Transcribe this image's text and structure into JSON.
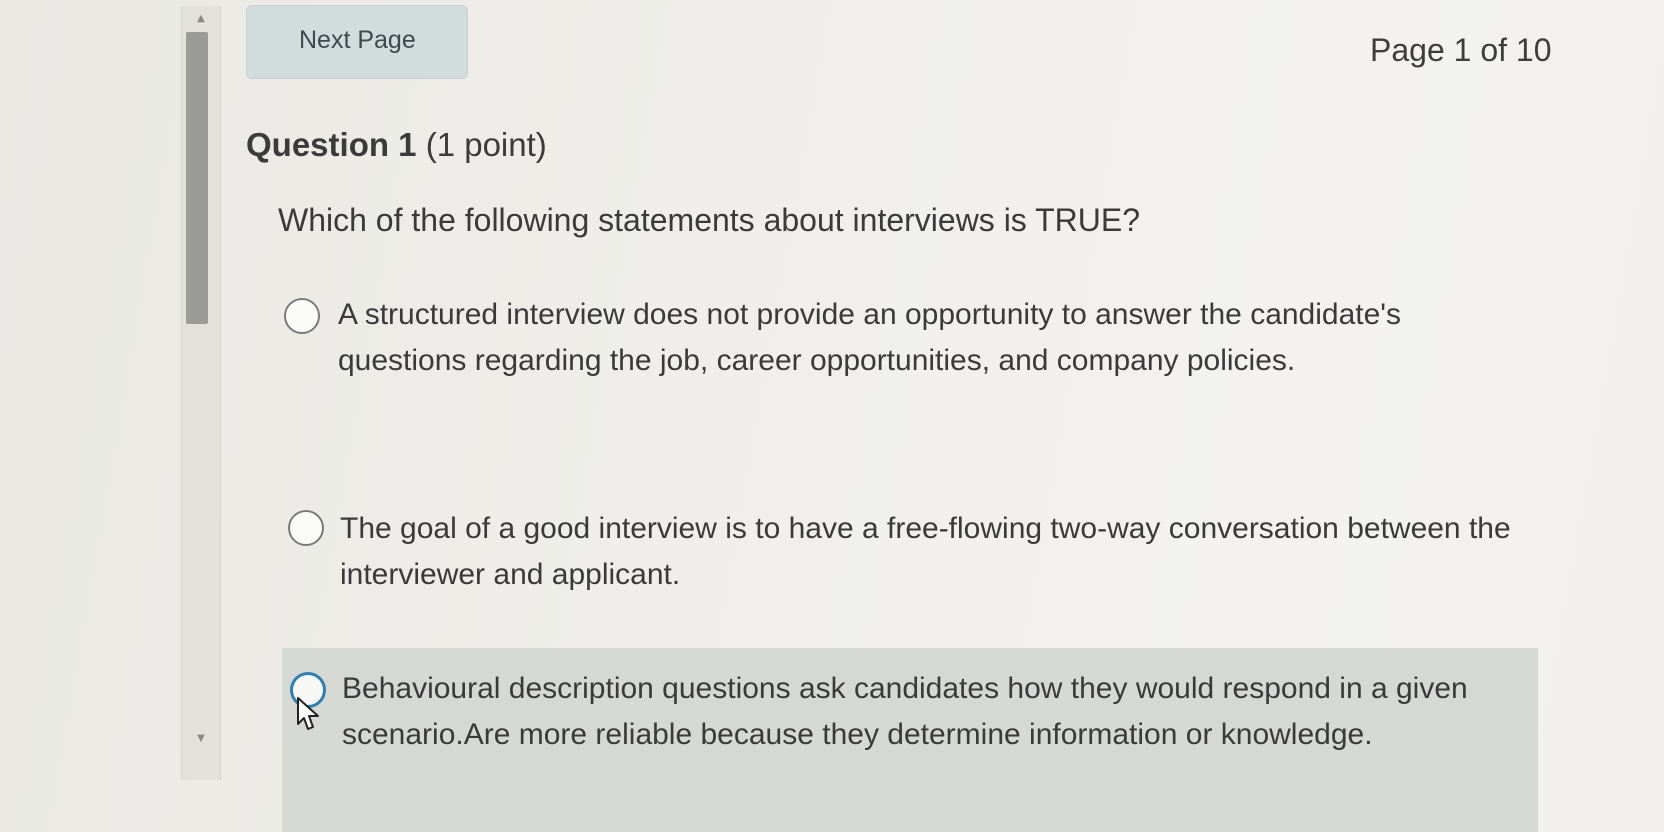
{
  "navigation": {
    "next_page_label": "Next Page",
    "page_indicator": "Page 1 of 10"
  },
  "question": {
    "number_label": "Question 1",
    "points_label": "(1 point)",
    "prompt": "Which of the following statements about interviews is TRUE?",
    "options": [
      {
        "text": "A structured interview does not provide an opportunity to answer the candidate's questions regarding the job, career opportunities, and company policies.",
        "selected": false
      },
      {
        "text": "The goal of a good interview is to have a free-flowing two-way conversation between the interviewer and applicant.",
        "selected": false
      },
      {
        "text": "Behavioural description questions ask candidates how they would respond in a given scenario.Are more reliable because they determine information or knowledge.",
        "selected": false,
        "hovered": true
      }
    ]
  },
  "icons": {
    "scroll_up": "scroll-up-arrow-icon",
    "scroll_down": "scroll-down-arrow-icon",
    "cursor": "mouse-pointer-icon"
  },
  "colors": {
    "button_background": "#d2dcdc",
    "hover_background": "#d6d8d4",
    "radio_focus": "#2f7fb0"
  }
}
